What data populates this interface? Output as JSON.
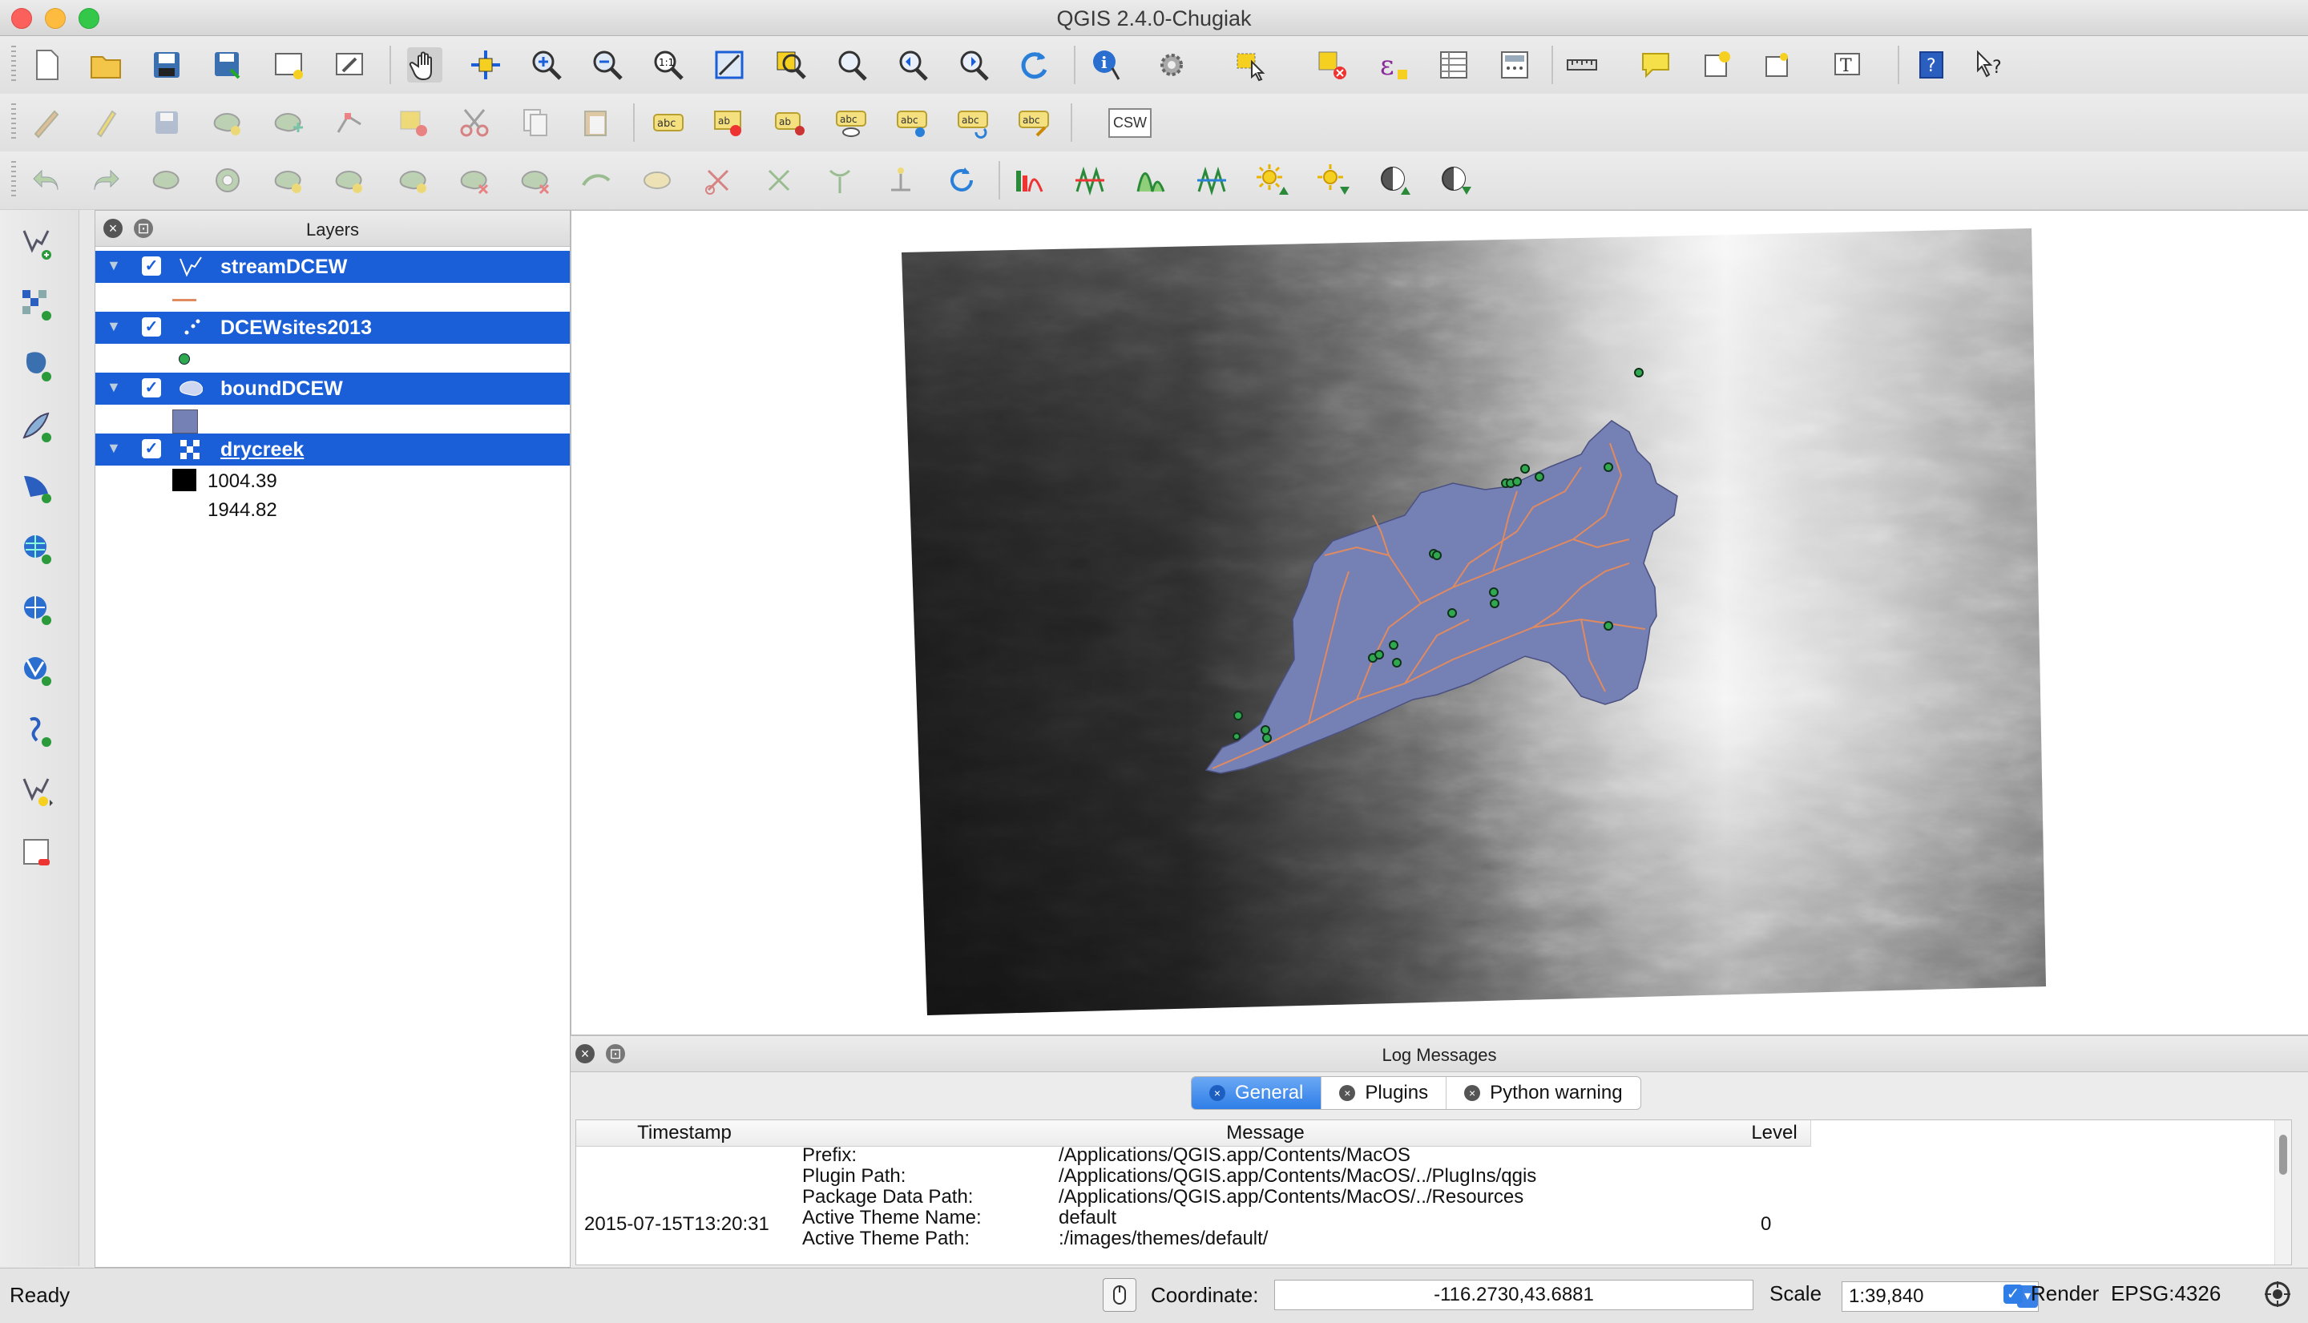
{
  "window": {
    "title": "QGIS 2.4.0-Chugiak"
  },
  "layers_panel": {
    "title": "Layers",
    "layers": [
      {
        "name": "streamDCEW",
        "checked": true
      },
      {
        "name": "DCEWsites2013",
        "checked": true
      },
      {
        "name": "boundDCEW",
        "checked": true
      },
      {
        "name": "drycreek",
        "checked": true,
        "legend": [
          "1004.39",
          "1944.82"
        ]
      }
    ]
  },
  "toolbar": {
    "csw_label": "CSW"
  },
  "log": {
    "title": "Log Messages",
    "tabs": [
      "General",
      "Plugins",
      "Python warning"
    ],
    "active_tab": "General",
    "columns": [
      "Timestamp",
      "Message",
      "Level"
    ],
    "entry": {
      "timestamp": "2015-07-15T13:20:31",
      "level": "0",
      "lines": [
        {
          "key": "Prefix:",
          "value": "/Applications/QGIS.app/Contents/MacOS"
        },
        {
          "key": "Plugin Path:",
          "value": "/Applications/QGIS.app/Contents/MacOS/../PlugIns/qgis"
        },
        {
          "key": "Package Data Path:",
          "value": "/Applications/QGIS.app/Contents/MacOS/../Resources"
        },
        {
          "key": "Active Theme Name:",
          "value": "default"
        },
        {
          "key": "Active Theme Path:",
          "value": ":/images/themes/default/"
        }
      ]
    }
  },
  "status": {
    "message": "Ready",
    "coordinate_label": "Coordinate:",
    "coordinate": "-116.2730,43.6881",
    "scale_label": "Scale",
    "scale": "1:39,840",
    "render_label": "Render",
    "render_checked": true,
    "crs": "EPSG:4326"
  },
  "colors": {
    "selection_blue": "#1a5fd8",
    "watershed_fill": "#7580b4",
    "stream": "#e08a60",
    "sites": "#2fa84f"
  }
}
